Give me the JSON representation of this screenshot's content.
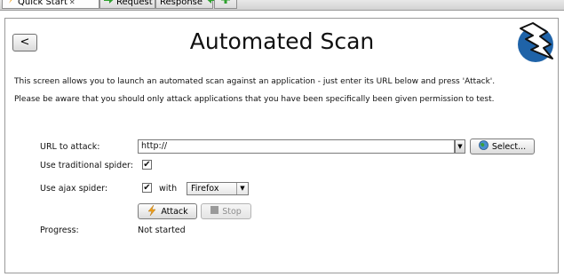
{
  "tabs": [
    {
      "label": "Quick Start",
      "pin": "✕",
      "icon": "lightning-icon",
      "active": true
    },
    {
      "label": "Request",
      "icon": "arrow-right-icon",
      "active": false
    },
    {
      "label": "Response",
      "icon": "arrow-left-icon",
      "active": false
    },
    {
      "label": "",
      "icon": "plus-icon",
      "active": false
    }
  ],
  "header": {
    "back_label": "<",
    "title": "Automated Scan",
    "logo_icon": "zap-logo-icon"
  },
  "description": {
    "line1": "This screen allows you to launch an automated scan against  an application - just enter its URL below and press 'Attack'.",
    "line2": "Please be aware that you should only attack applications that you have been specifically been given permission to test."
  },
  "form": {
    "url_label": "URL to attack:",
    "url_value": "http://",
    "select_label": "Select...",
    "traditional_label": "Use traditional spider:",
    "traditional_checked": true,
    "ajax_label": "Use ajax spider:",
    "ajax_checked": true,
    "with_label": "with",
    "browser_value": "Firefox",
    "attack_label": "Attack",
    "stop_label": "Stop",
    "progress_label": "Progress:",
    "progress_value": "Not started",
    "check_glyph": "✔"
  },
  "colors": {
    "logo_blue": "#1f63a8",
    "lightning": "#f0a11c",
    "accent_green": "#2da02d"
  }
}
